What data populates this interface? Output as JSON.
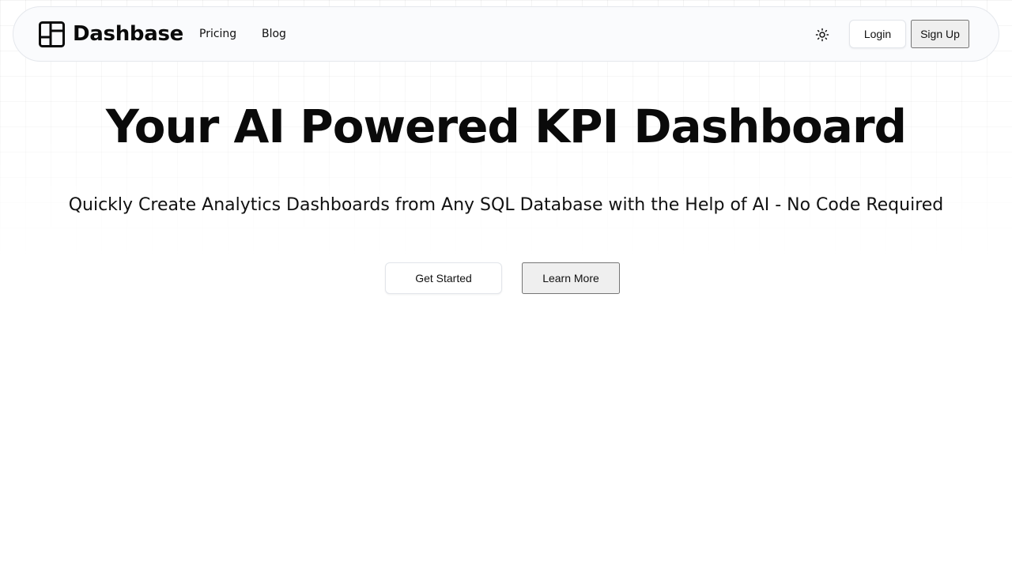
{
  "brand": {
    "name": "Dashbase",
    "icon": "dashboard-layout-icon"
  },
  "nav": {
    "links": [
      {
        "label": "Pricing"
      },
      {
        "label": "Blog"
      }
    ],
    "theme_toggle_icon": "sun-icon",
    "login_label": "Login",
    "signup_label": "Sign Up"
  },
  "hero": {
    "title": "Your AI Powered KPI Dashboard",
    "subtitle": "Quickly Create Analytics Dashboards from Any SQL Database with the Help of AI - No Code Required",
    "primary_cta": "Get Started",
    "secondary_cta": "Learn More"
  },
  "colors": {
    "text": "#0a0a0a",
    "navbar_bg": "#fafbfd",
    "border": "#e4e7ec",
    "background": "#ffffff"
  }
}
